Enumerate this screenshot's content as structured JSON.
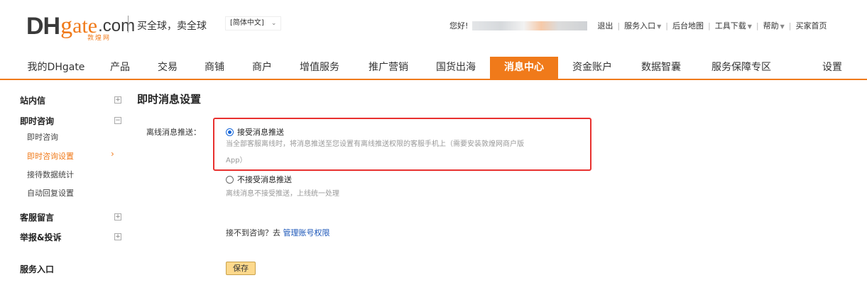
{
  "header": {
    "logo": {
      "dh": "DH",
      "g": "g",
      "rest": "ate",
      "dotcom": ".com",
      "sub": "敦煌网"
    },
    "slogan": "买全球，卖全球",
    "language": {
      "selected": "[简体中文]",
      "icon": "chevron-down-icon"
    },
    "greeting": "您好!",
    "links": [
      {
        "label": "退出",
        "dropdown": false
      },
      {
        "label": "服务入口",
        "dropdown": true
      },
      {
        "label": "后台地图",
        "dropdown": false
      },
      {
        "label": "工具下载",
        "dropdown": true
      },
      {
        "label": "帮助",
        "dropdown": true
      },
      {
        "label": "买家首页",
        "dropdown": false
      }
    ]
  },
  "nav": {
    "items": [
      {
        "label": "我的DHgate",
        "active": false
      },
      {
        "label": "产品",
        "active": false
      },
      {
        "label": "交易",
        "active": false
      },
      {
        "label": "商铺",
        "active": false
      },
      {
        "label": "商户",
        "active": false
      },
      {
        "label": "增值服务",
        "active": false
      },
      {
        "label": "推广营销",
        "active": false
      },
      {
        "label": "国货出海",
        "active": false
      },
      {
        "label": "消息中心",
        "active": true
      },
      {
        "label": "资金账户",
        "active": false
      },
      {
        "label": "数据智囊",
        "active": false
      },
      {
        "label": "服务保障专区",
        "active": false
      },
      {
        "label": "设置",
        "active": false
      }
    ]
  },
  "sidebar": {
    "groups": [
      {
        "label": "站内信",
        "toggle": "+",
        "expanded": false
      },
      {
        "label": "即时咨询",
        "toggle": "−",
        "expanded": true,
        "children": [
          {
            "label": "即时咨询",
            "active": false
          },
          {
            "label": "即时咨询设置",
            "active": true
          },
          {
            "label": "接待数据统计",
            "active": false
          },
          {
            "label": "自动回复设置",
            "active": false
          }
        ]
      },
      {
        "label": "客服留言",
        "toggle": "+",
        "expanded": false
      },
      {
        "label": "举报&投诉",
        "toggle": "+",
        "expanded": false
      },
      {
        "label": "服务入口"
      }
    ]
  },
  "content": {
    "title": "即时消息设置",
    "field_label": "离线消息推送：",
    "options": [
      {
        "label": "接受消息推送",
        "checked": true,
        "hint_line1": "当全部客服离线时，将消息推送至您设置有离线推送权限的客服手机上（需要安装敦煌网商户版",
        "hint_line2": "App）"
      },
      {
        "label": "不接受消息推送",
        "checked": false,
        "hint_line1": "离线消息不接受推送，上线统一处理"
      }
    ],
    "help_text": "接不到咨询？去",
    "help_link": "管理账号权限",
    "save_label": "保存"
  },
  "colors": {
    "accent": "#f07a1a",
    "highlight_border": "#e8312f",
    "link": "#1a55b8",
    "radio": "#1565d8",
    "save_bg": "#fdd98c"
  }
}
